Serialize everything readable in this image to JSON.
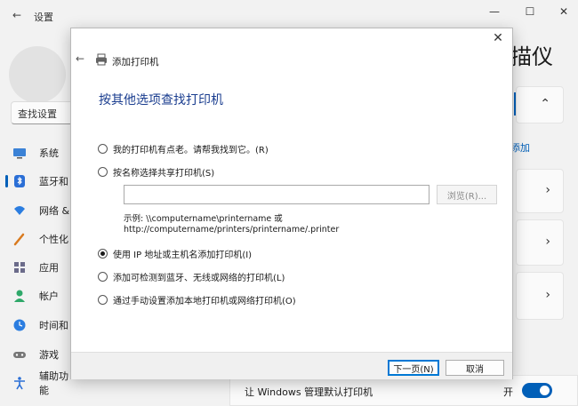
{
  "settings": {
    "window_title": "设置",
    "search_placeholder": "查找设置",
    "page_title_partial": "描仪",
    "add_link_partial": "添加",
    "nav": [
      {
        "label": "系统",
        "icon": "monitor-icon"
      },
      {
        "label": "蓝牙和",
        "icon": "bluetooth-icon"
      },
      {
        "label": "网络 &",
        "icon": "wifi-icon"
      },
      {
        "label": "个性化",
        "icon": "brush-icon"
      },
      {
        "label": "应用",
        "icon": "apps-icon"
      },
      {
        "label": "帐户",
        "icon": "account-icon"
      },
      {
        "label": "时间和",
        "icon": "clock-icon"
      },
      {
        "label": "游戏",
        "icon": "gamepad-icon"
      },
      {
        "label": "辅助功能",
        "icon": "accessibility-icon"
      }
    ],
    "bottom_setting": {
      "label": "让 Windows 管理默认打印机",
      "state_label": "开"
    },
    "accent_color": "#005fb8"
  },
  "dialog": {
    "title": "添加打印机",
    "heading": "按其他选项查找打印机",
    "options": [
      {
        "label": "我的打印机有点老。请帮我找到它。(R)",
        "checked": false
      },
      {
        "label": "按名称选择共享打印机(S)",
        "checked": false
      },
      {
        "label": "使用 IP 地址或主机名添加打印机(I)",
        "checked": true
      },
      {
        "label": "添加可检测到蓝牙、无线或网络的打印机(L)",
        "checked": false
      },
      {
        "label": "通过手动设置添加本地打印机或网络打印机(O)",
        "checked": false
      }
    ],
    "share_input_value": "",
    "browse_label": "浏览(R)...",
    "example_line1": "示例: \\\\computername\\printername 或",
    "example_line2": "http://computername/printers/printername/.printer",
    "next_label": "下一页(N)",
    "cancel_label": "取消"
  }
}
